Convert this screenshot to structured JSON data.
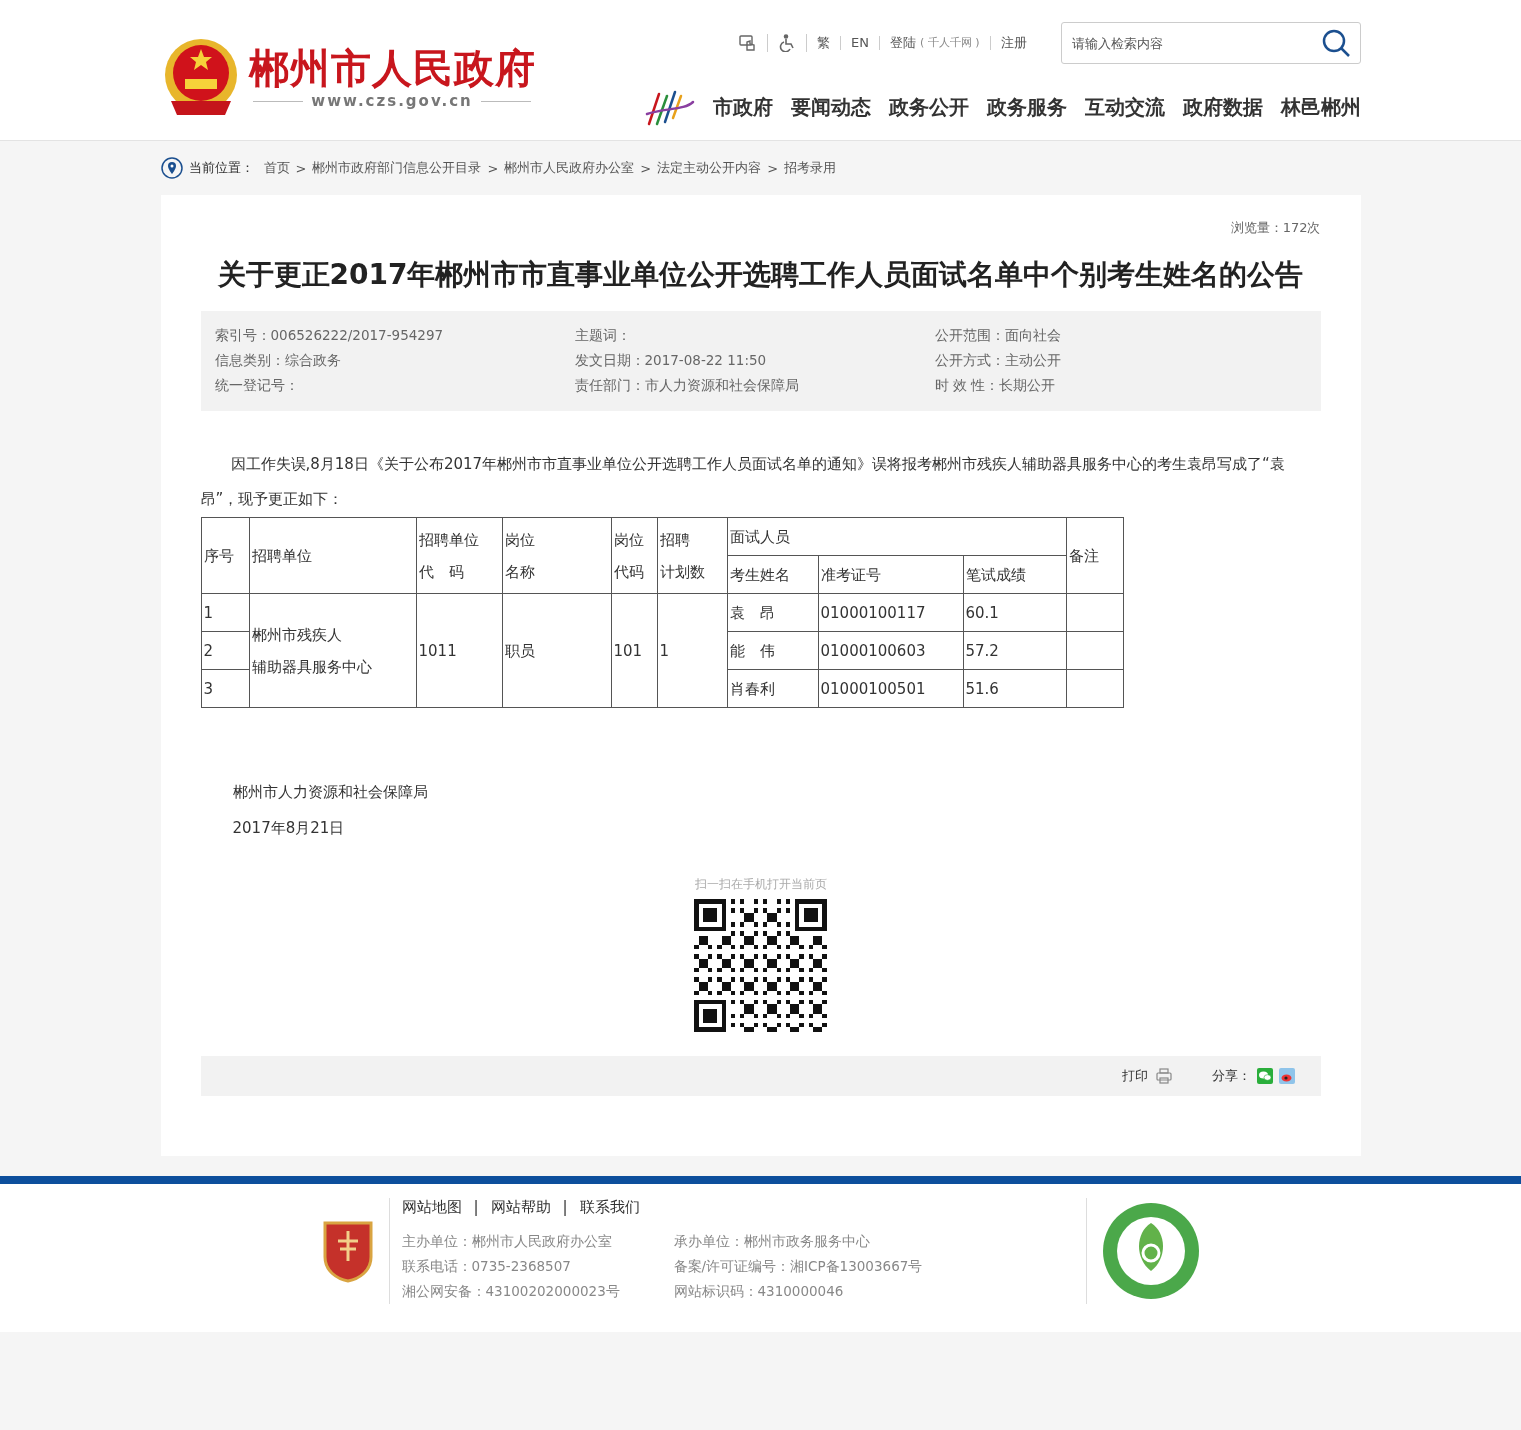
{
  "header": {
    "site_name": "郴州市人民政府",
    "site_url": "www.czs.gov.cn",
    "toolbar": [
      {
        "kind": "touch"
      },
      {
        "kind": "accessibility"
      },
      {
        "kind": "link",
        "label": "繁"
      },
      {
        "kind": "link",
        "label": "EN"
      },
      {
        "kind": "login",
        "label": "登陆",
        "note": "( 千人千网 )"
      },
      {
        "kind": "link",
        "label": "注册"
      }
    ],
    "search": {
      "placeholder": "请输入检索内容"
    },
    "nav": [
      {
        "label": "市政府",
        "selected": false
      },
      {
        "label": "要闻动态",
        "selected": false
      },
      {
        "label": "政务公开",
        "selected": false
      },
      {
        "label": "政务服务",
        "selected": false
      },
      {
        "label": "互动交流",
        "selected": false
      },
      {
        "label": "政府数据",
        "selected": false
      },
      {
        "label": "林邑郴州",
        "selected": false
      }
    ]
  },
  "breadcrumb": {
    "label": "当前位置：",
    "items": [
      "首页",
      "郴州市政府部门信息公开目录",
      "郴州市人民政府办公室",
      "法定主动公开内容",
      "招考录用"
    ],
    "separator": ">"
  },
  "article": {
    "views": "浏览量：172次",
    "title": "关于更正2017年郴州市市直事业单位公开选聘工作人员面试名单中个别考生姓名的公告",
    "meta": [
      [
        "索引号：006526222/2017-954297",
        "主题词：",
        "公开范围：面向社会"
      ],
      [
        "信息类别：综合政务",
        "发文日期：2017-08-22 11:50",
        "公开方式：主动公开"
      ],
      [
        "统一登记号：",
        "责任部门：市人力资源和社会保障局",
        "时 效 性：长期公开"
      ]
    ],
    "paragraph": "因工作失误,8月18日《关于公布2017年郴州市市直事业单位公开选聘工作人员面试名单的通知》误将报考郴州市残疾人辅助器具服务中心的考生袁昂写成了“袁昂”，现予更正如下：",
    "table": {
      "head": {
        "seq": "序号",
        "unit": "招聘单位",
        "unit_code": [
          "招聘单位",
          "代　码"
        ],
        "post": [
          "岗位",
          "名称"
        ],
        "post_code": [
          "岗位",
          "代码"
        ],
        "plan": [
          "招聘",
          "计划数"
        ],
        "group": "面试人员",
        "sub": [
          "考生姓名",
          "准考证号",
          "笔试成绩"
        ],
        "note": "备注"
      },
      "shared": {
        "unit": [
          "郴州市残疾人",
          "辅助器具服务中心"
        ],
        "unit_code": "1011",
        "post": "职员",
        "post_code": "101",
        "plan": "1"
      },
      "rows": [
        {
          "seq": "1",
          "name": "袁　昂",
          "ticket": "01000100117",
          "score": "60.1"
        },
        {
          "seq": "2",
          "name": "能　伟",
          "ticket": "01000100603",
          "score": "57.2"
        },
        {
          "seq": "3",
          "name": "肖春利",
          "ticket": "01000100501",
          "score": "51.6"
        }
      ]
    },
    "signature": [
      "郴州市人力资源和社会保障局",
      "2017年8月21日"
    ],
    "qr_caption": "扫一扫在手机打开当前页",
    "actions": {
      "print": "打印",
      "share": "分享："
    }
  },
  "footer": {
    "links": [
      "网站地图",
      "网站帮助",
      "联系我们"
    ],
    "link_separator": "|",
    "info": [
      [
        "主办单位：郴州市人民政府办公室",
        "联系电话：0735-2368507",
        "湘公网安备：43100202000023号"
      ],
      [
        "承办单位：郴州市政务服务中心",
        "备案/许可证编号：湘ICP备13003667号",
        "网站标识码：4310000046"
      ]
    ]
  }
}
